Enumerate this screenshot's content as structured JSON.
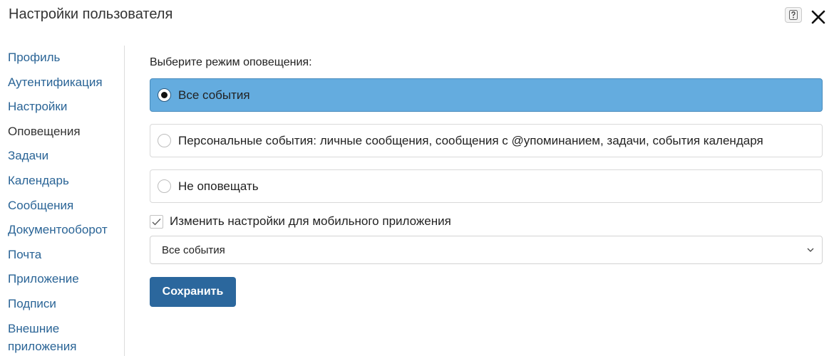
{
  "header": {
    "title": "Настройки пользователя",
    "help_icon": "question-icon",
    "close_icon": "close-icon"
  },
  "sidebar": {
    "items": [
      {
        "label": "Профиль"
      },
      {
        "label": "Аутентификация"
      },
      {
        "label": "Настройки"
      },
      {
        "label": "Оповещения",
        "active": true
      },
      {
        "label": "Задачи"
      },
      {
        "label": "Календарь"
      },
      {
        "label": "Сообщения"
      },
      {
        "label": "Документооборот"
      },
      {
        "label": "Почта"
      },
      {
        "label": "Приложение"
      },
      {
        "label": "Подписи"
      },
      {
        "label": "Внешние приложения"
      }
    ]
  },
  "main": {
    "prompt": "Выберите режим оповещения:",
    "options": [
      {
        "label": "Все события",
        "selected": true
      },
      {
        "label": "Персональные события: личные сообщения, сообщения с @упоминанием, задачи, события календаря",
        "selected": false
      },
      {
        "label": "Не оповещать",
        "selected": false
      }
    ],
    "mobile_checkbox": {
      "label": "Изменить настройки для мобильного приложения",
      "checked": true
    },
    "mobile_select": {
      "value": "Все события"
    },
    "save_label": "Сохранить"
  },
  "colors": {
    "link": "#2a6496",
    "selected_option_bg": "#64acdf",
    "primary_button": "#2b679d"
  }
}
